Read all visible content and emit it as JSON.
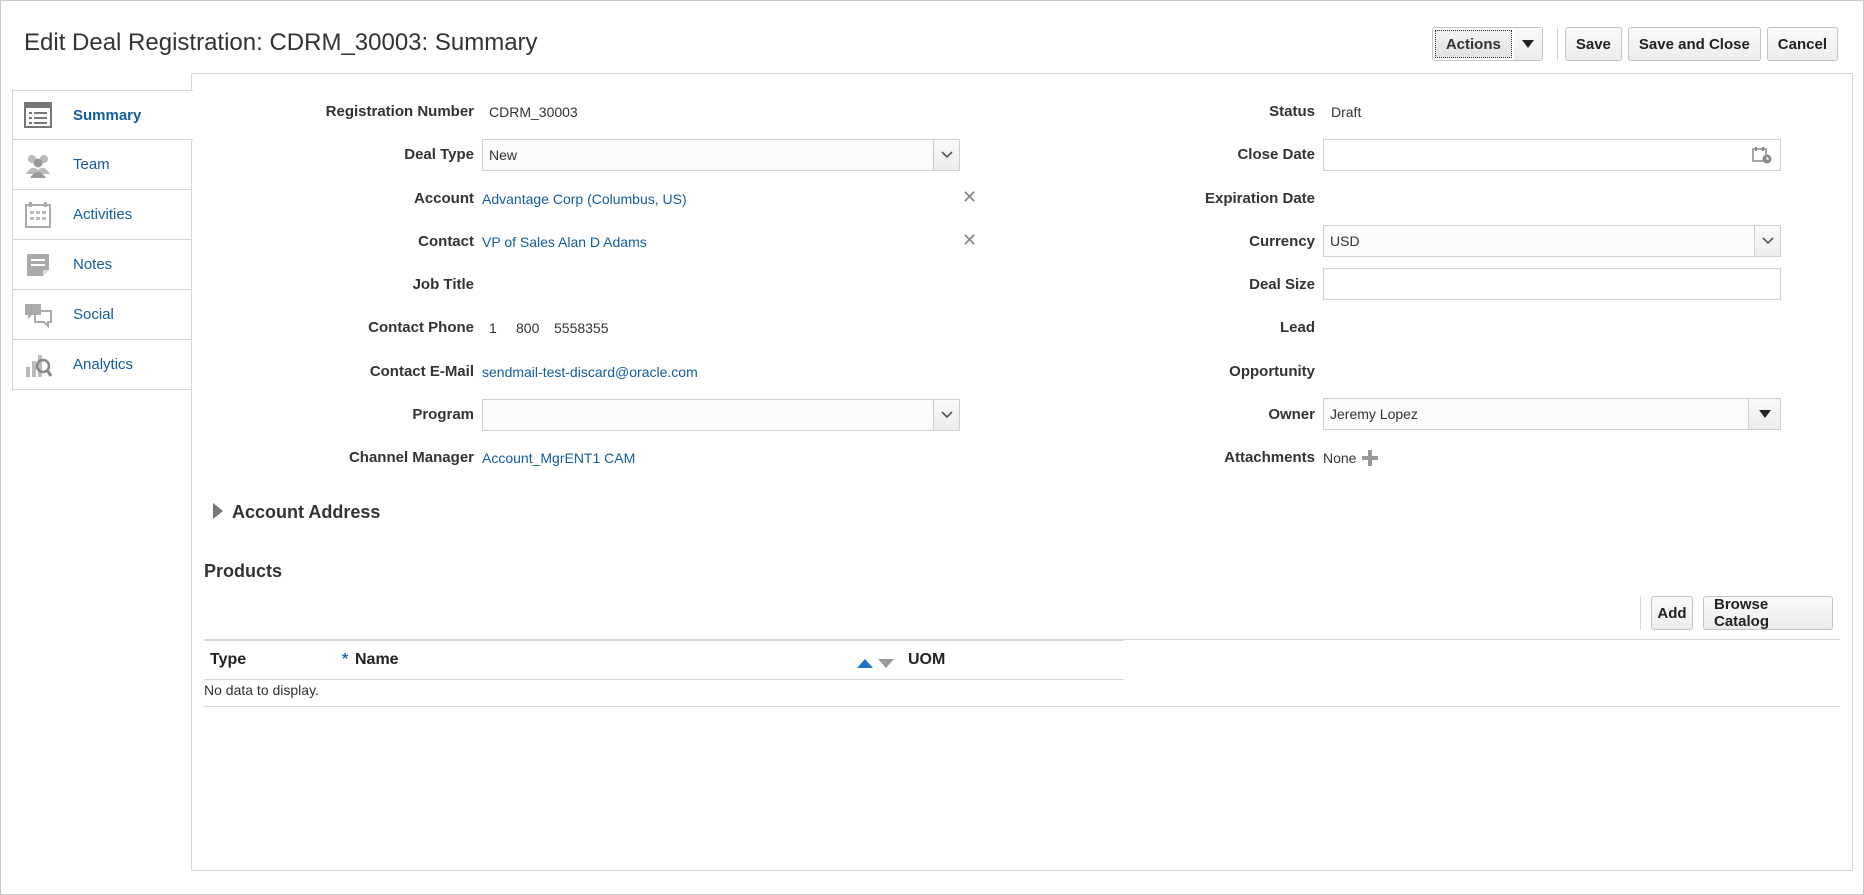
{
  "header": {
    "title": "Edit Deal Registration: CDRM_30003: Summary",
    "actions_label": "Actions",
    "save_label": "Save",
    "save_close_label": "Save and Close",
    "cancel_label": "Cancel"
  },
  "sidebar": {
    "items": [
      {
        "label": "Summary",
        "icon": "summary-icon",
        "active": true
      },
      {
        "label": "Team",
        "icon": "team-icon"
      },
      {
        "label": "Activities",
        "icon": "activities-icon"
      },
      {
        "label": "Notes",
        "icon": "notes-icon"
      },
      {
        "label": "Social",
        "icon": "social-icon"
      },
      {
        "label": "Analytics",
        "icon": "analytics-icon"
      }
    ]
  },
  "form": {
    "left": {
      "registration_number": {
        "label": "Registration Number",
        "value": "CDRM_30003"
      },
      "deal_type": {
        "label": "Deal Type",
        "value": "New"
      },
      "account": {
        "label": "Account",
        "value": "Advantage Corp (Columbus, US)"
      },
      "contact": {
        "label": "Contact",
        "value": "VP of Sales Alan D Adams"
      },
      "job_title": {
        "label": "Job Title",
        "value": ""
      },
      "contact_phone": {
        "label": "Contact Phone",
        "country": "1",
        "area": "800",
        "number": "5558355"
      },
      "contact_email": {
        "label": "Contact E-Mail",
        "value": "sendmail-test-discard@oracle.com"
      },
      "program": {
        "label": "Program",
        "value": ""
      },
      "channel_manager": {
        "label": "Channel Manager",
        "value": "Account_MgrENT1 CAM"
      }
    },
    "right": {
      "status": {
        "label": "Status",
        "value": "Draft"
      },
      "close_date": {
        "label": "Close Date",
        "value": ""
      },
      "expiration_date": {
        "label": "Expiration Date",
        "value": ""
      },
      "currency": {
        "label": "Currency",
        "value": "USD"
      },
      "deal_size": {
        "label": "Deal Size",
        "value": ""
      },
      "lead": {
        "label": "Lead",
        "value": ""
      },
      "opportunity": {
        "label": "Opportunity",
        "value": ""
      },
      "owner": {
        "label": "Owner",
        "value": "Jeremy Lopez"
      },
      "attachments": {
        "label": "Attachments",
        "value": "None"
      }
    }
  },
  "account_address": {
    "label": "Account Address"
  },
  "products": {
    "title": "Products",
    "add_label": "Add",
    "browse_label": "Browse Catalog",
    "columns": {
      "type": "Type",
      "required_mark": "*",
      "name": "Name",
      "uom": "UOM"
    },
    "empty_text": "No data to display."
  },
  "colors": {
    "link": "#145c9e",
    "sort_asc": "#1a73c7"
  }
}
